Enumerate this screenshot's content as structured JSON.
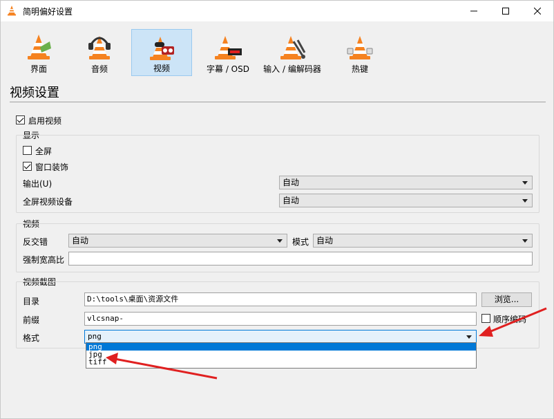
{
  "window": {
    "title": "简明偏好设置",
    "controls": {
      "minimize": "minimize-icon",
      "maximize": "maximize-icon",
      "close": "close-icon"
    }
  },
  "categories": [
    {
      "label": "界面",
      "icon": "vlc-cone-icon",
      "selected": false
    },
    {
      "label": "音频",
      "icon": "headphones-cone-icon",
      "selected": false
    },
    {
      "label": "视频",
      "icon": "video-cone-icon",
      "selected": true
    },
    {
      "label": "字幕 / OSD",
      "icon": "subtitle-cone-icon",
      "selected": false
    },
    {
      "label": "输入 / 编解码器",
      "icon": "codec-cone-icon",
      "selected": false
    },
    {
      "label": "热键",
      "icon": "hotkey-cone-icon",
      "selected": false
    }
  ],
  "page": {
    "title": "视频设置"
  },
  "enable_video": {
    "label": "启用视频",
    "checked": true
  },
  "display": {
    "title": "显示",
    "fullscreen": {
      "label": "全屏",
      "checked": false
    },
    "window_decorations": {
      "label": "窗口装饰",
      "checked": true
    },
    "output": {
      "label": "输出(U)",
      "value": "自动"
    },
    "fullscreen_device": {
      "label": "全屏视频设备",
      "value": "自动"
    }
  },
  "video": {
    "title": "视频",
    "deinterlace": {
      "label": "反交错",
      "value": "自动"
    },
    "mode": {
      "label": "模式",
      "value": "自动"
    },
    "aspect_ratio": {
      "label": "强制宽高比",
      "value": ""
    }
  },
  "snapshot": {
    "title": "视频截图",
    "directory": {
      "label": "目录",
      "value": "D:\\tools\\桌面\\资源文件",
      "browse_label": "浏览..."
    },
    "prefix": {
      "label": "前缀",
      "value": "vlcsnap-",
      "sequential_label": "顺序编码",
      "sequential_checked": false
    },
    "format": {
      "label": "格式",
      "value": "png",
      "options": [
        "png",
        "jpg",
        "tiff"
      ],
      "highlighted": "png"
    }
  },
  "colors": {
    "accent": "#0078d7",
    "selection_bg": "#cce4f7",
    "arrow": "#e02020"
  }
}
